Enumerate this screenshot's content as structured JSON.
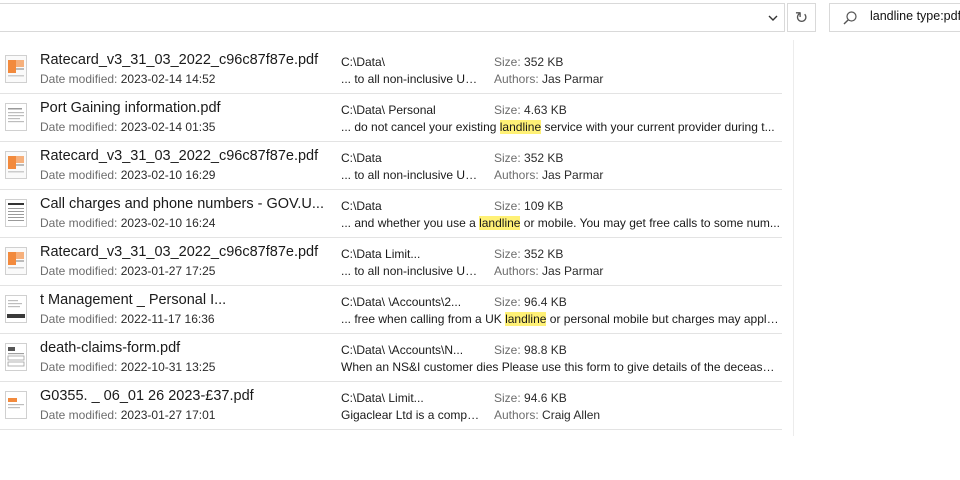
{
  "topbar": {
    "refresh_glyph": "↻",
    "search_value": "landline type:pdf"
  },
  "results": [
    {
      "icon": "pdf-thumbnail-orange",
      "name": "Ratecard_v3_31_03_2022_c96c87f87e.pdf",
      "date_label": "Date modified:",
      "date": "2023-02-14 14:52",
      "path": "C:\\Data\\",
      "size_label": "Size:",
      "size": "352 KB",
      "snippet_before": "... to all non-inclusive UK...",
      "highlight": "",
      "snippet_after": "",
      "authors_label": "Authors:",
      "authors": "Jas Parmar"
    },
    {
      "icon": "pdf-thumbnail-document",
      "name": "Port Gaining information.pdf",
      "date_label": "Date modified:",
      "date": "2023-02-14 01:35",
      "path": "C:\\Data\\    Personal",
      "size_label": "Size:",
      "size": "4.63 KB",
      "snippet_before": "... do not cancel your existing ",
      "highlight": "landline",
      "snippet_after": " service with your current provider during t...",
      "authors_label": "",
      "authors": ""
    },
    {
      "icon": "pdf-thumbnail-orange",
      "name": "Ratecard_v3_31_03_2022_c96c87f87e.pdf",
      "date_label": "Date modified:",
      "date": "2023-02-10 16:29",
      "path": "C:\\Data",
      "size_label": "Size:",
      "size": "352 KB",
      "snippet_before": "... to all non-inclusive UK...",
      "highlight": "",
      "snippet_after": "",
      "authors_label": "Authors:",
      "authors": "Jas Parmar"
    },
    {
      "icon": "pdf-thumbnail-table",
      "name": "Call charges and phone numbers - GOV.U...",
      "date_label": "Date modified:",
      "date": "2023-02-10 16:24",
      "path": "C:\\Data",
      "size_label": "Size:",
      "size": "109 KB",
      "snippet_before": "... and whether you use a ",
      "highlight": "landline",
      "snippet_after": " or mobile. You may get free calls to some num...",
      "authors_label": "",
      "authors": ""
    },
    {
      "icon": "pdf-thumbnail-orange",
      "name": "Ratecard_v3_31_03_2022_c96c87f87e.pdf",
      "date_label": "Date modified:",
      "date": "2023-01-27 17:25",
      "path": "C:\\Data                  Limit...",
      "size_label": "Size:",
      "size": "352 KB",
      "snippet_before": "... to all non-inclusive UK...",
      "highlight": "",
      "snippet_after": "",
      "authors_label": "Authors:",
      "authors": "Jas Parmar"
    },
    {
      "icon": "pdf-thumbnail-dark",
      "name": "t Management _ Personal I...",
      "date_label": "Date modified:",
      "date": "2022-11-17 16:36",
      "path": "C:\\Data\\     \\Accounts\\2...",
      "size_label": "Size:",
      "size": "96.4 KB",
      "snippet_before": "... free when calling from a UK ",
      "highlight": "landline",
      "snippet_after": " or personal mobile but charges may apply ...",
      "authors_label": "",
      "authors": ""
    },
    {
      "icon": "pdf-thumbnail-form",
      "name": "death-claims-form.pdf",
      "date_label": "Date modified:",
      "date": "2022-10-31 13:25",
      "path": "C:\\Data\\      \\Accounts\\N...",
      "size_label": "Size:",
      "size": "98.8 KB",
      "snippet_before": "When an NS&I customer dies Please use this form to give details of the deceased ...",
      "highlight": "",
      "snippet_after": "",
      "authors_label": "",
      "authors": ""
    },
    {
      "icon": "pdf-thumbnail-orange-small",
      "name": "G0355.    _       06_01 26 2023-£37.pdf",
      "date_label": "Date modified:",
      "date": "2023-01-27 17:01",
      "path": "C:\\Data\\                  Limit...",
      "size_label": "Size:",
      "size": "94.6 KB",
      "snippet_before": "Gigaclear Ltd is a compa...",
      "highlight": "",
      "snippet_after": "",
      "authors_label": "Authors:",
      "authors": "Craig Allen"
    }
  ]
}
